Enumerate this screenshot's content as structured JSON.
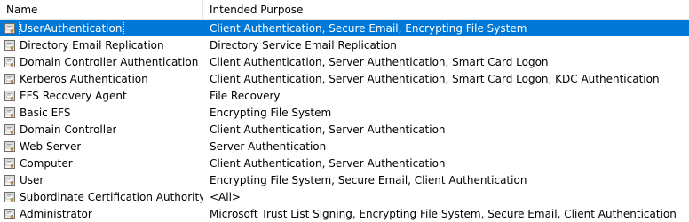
{
  "columns": {
    "name": "Name",
    "purpose": "Intended Purpose"
  },
  "selection_color": "#0078d7",
  "icon": "certificate-template-icon",
  "rows": [
    {
      "name": "UserAuthentication",
      "purpose": "Client Authentication, Secure Email, Encrypting File System",
      "selected": true
    },
    {
      "name": "Directory Email Replication",
      "purpose": "Directory Service Email Replication"
    },
    {
      "name": "Domain Controller Authentication",
      "purpose": "Client Authentication, Server Authentication, Smart Card Logon"
    },
    {
      "name": "Kerberos Authentication",
      "purpose": "Client Authentication, Server Authentication, Smart Card Logon, KDC Authentication"
    },
    {
      "name": "EFS Recovery Agent",
      "purpose": "File Recovery"
    },
    {
      "name": "Basic EFS",
      "purpose": "Encrypting File System"
    },
    {
      "name": "Domain Controller",
      "purpose": "Client Authentication, Server Authentication"
    },
    {
      "name": "Web Server",
      "purpose": "Server Authentication"
    },
    {
      "name": "Computer",
      "purpose": "Client Authentication, Server Authentication"
    },
    {
      "name": "User",
      "purpose": "Encrypting File System, Secure Email, Client Authentication"
    },
    {
      "name": "Subordinate Certification Authority",
      "purpose": "<All>"
    },
    {
      "name": "Administrator",
      "purpose": "Microsoft Trust List Signing, Encrypting File System, Secure Email, Client Authentication"
    }
  ]
}
